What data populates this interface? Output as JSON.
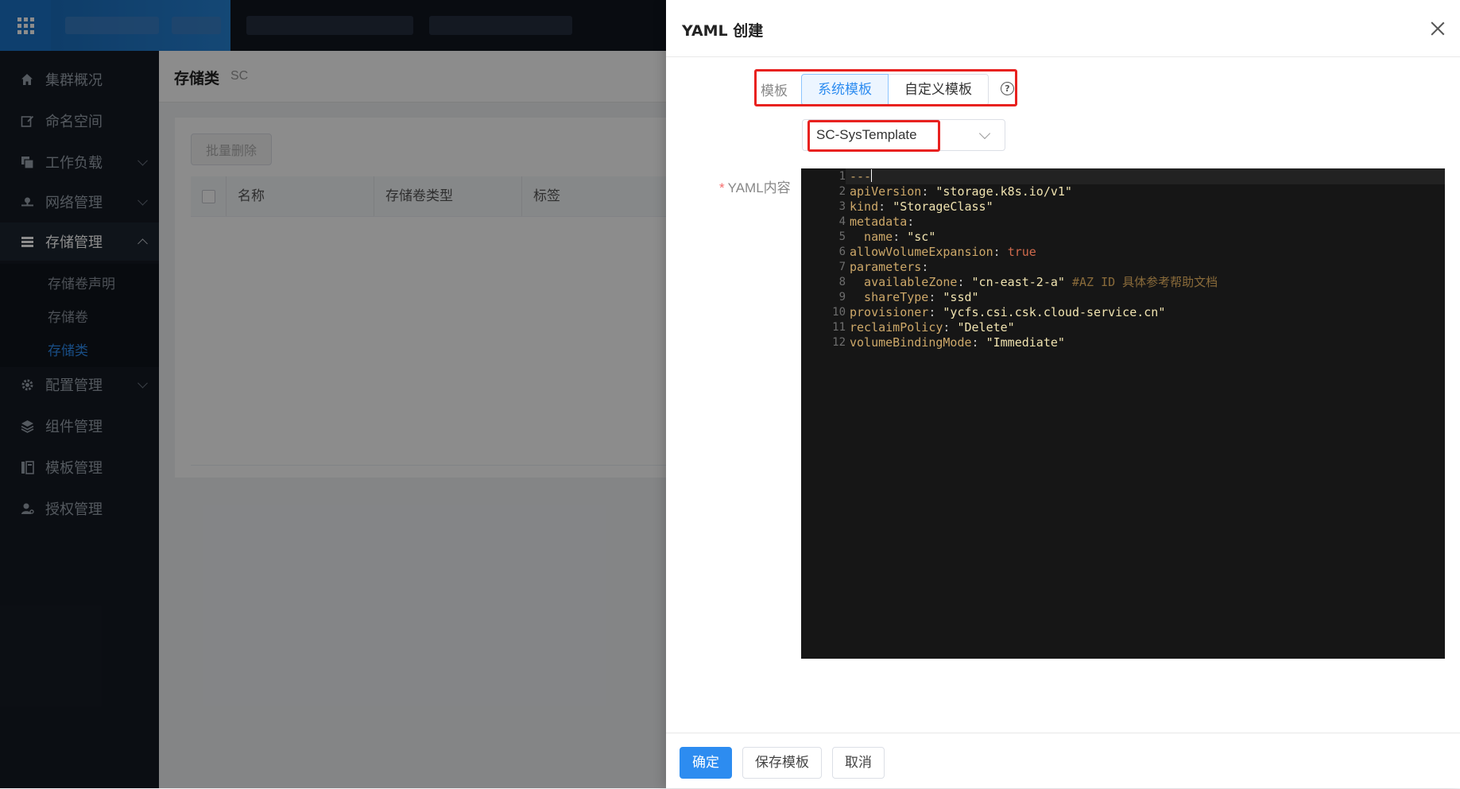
{
  "sidebar": {
    "items": [
      {
        "label": "集群概况",
        "icon": "home-icon"
      },
      {
        "label": "命名空间",
        "icon": "edit-icon"
      },
      {
        "label": "工作负载",
        "icon": "layers-icon"
      },
      {
        "label": "网络管理",
        "icon": "network-icon"
      },
      {
        "label": "存储管理",
        "icon": "storage-icon"
      },
      {
        "label": "配置管理",
        "icon": "gear-icon"
      },
      {
        "label": "组件管理",
        "icon": "stack-icon"
      },
      {
        "label": "模板管理",
        "icon": "template-icon"
      },
      {
        "label": "授权管理",
        "icon": "user-key-icon"
      }
    ],
    "storage_sub": [
      "存储卷声明",
      "存储卷",
      "存储类"
    ]
  },
  "page": {
    "title": "存储类",
    "subtitle": "SC",
    "batch_delete": "批量删除",
    "columns": [
      "名称",
      "存储卷类型",
      "标签"
    ]
  },
  "drawer": {
    "title": "YAML 创建",
    "template_label": "模板",
    "segments": {
      "system": "系统模板",
      "custom": "自定义模板"
    },
    "help_glyph": "?",
    "select_value": "SC-SysTemplate",
    "yaml_label": "YAML内容",
    "required_mark": "*",
    "buttons": {
      "confirm": "确定",
      "save_template": "保存模板",
      "cancel": "取消"
    }
  },
  "colors": {
    "accent": "#2d8cf0",
    "highlight": "#e8211f",
    "sidebar_bg": "#151b24",
    "editor_bg": "#161616"
  }
}
